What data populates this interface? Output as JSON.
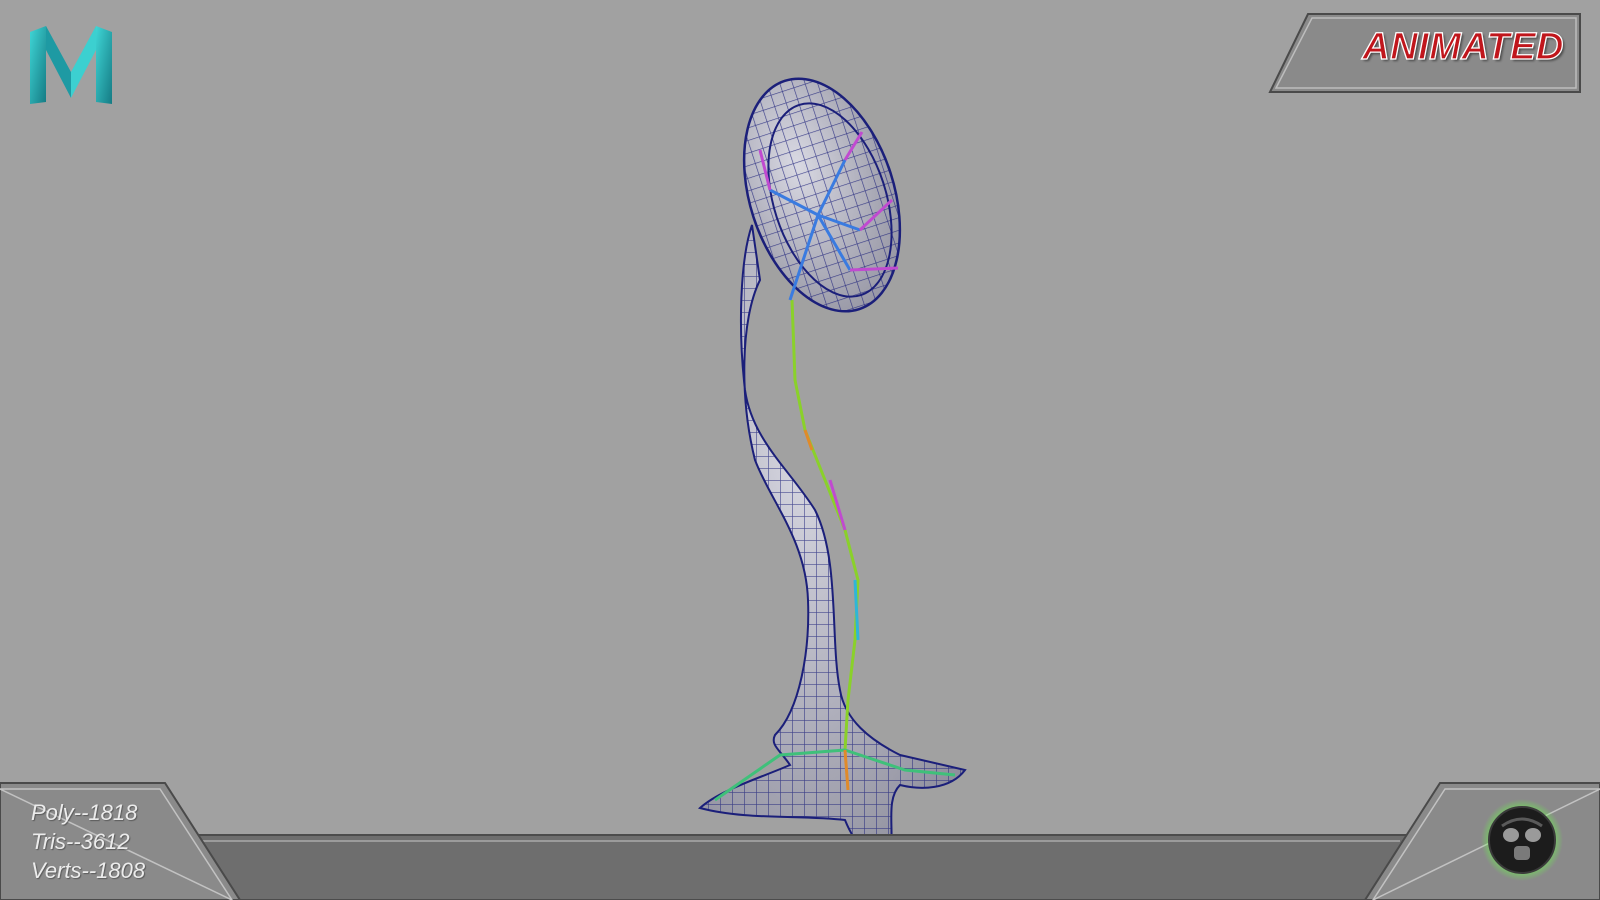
{
  "app": {
    "logo_icon": "maya-m-logo-icon",
    "logo_colors": [
      "#2fc7c9",
      "#1a8f99",
      "#157b84"
    ]
  },
  "badge": {
    "label": "ANIMATED",
    "text_color": "#c0161c",
    "outline_color": "#ffffff"
  },
  "viewport": {
    "background_color": "#a1a1a1",
    "wireframe_color": "#1b1f7a",
    "model_icon": "wireframe-stalk-model"
  },
  "stats": {
    "poly": "Poly--1818",
    "tris": "Tris--3612",
    "verts": "Verts--1808"
  },
  "studio": {
    "logo_icon": "gas-mask-logo-icon",
    "glow_color": "#66ff44"
  }
}
